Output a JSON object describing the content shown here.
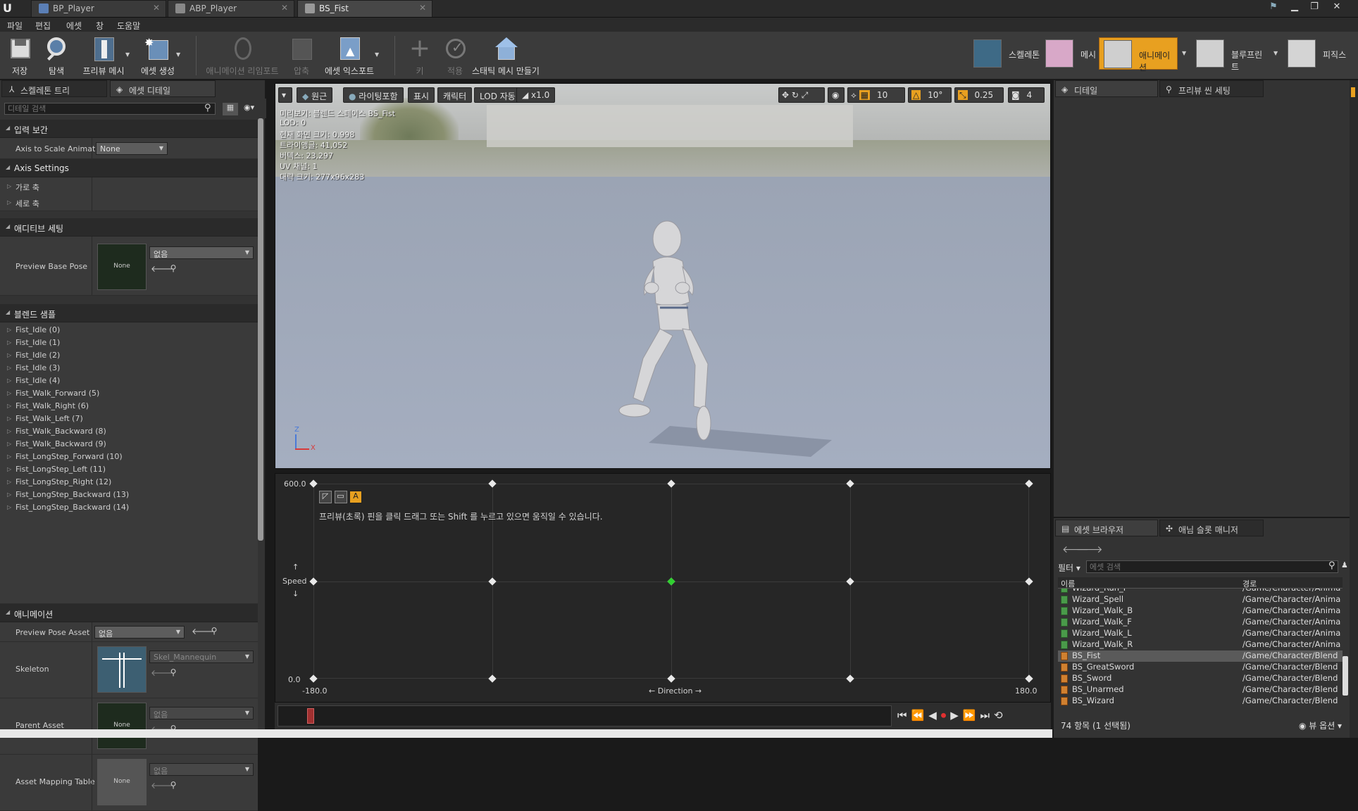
{
  "tabs": [
    {
      "label": "BP_Player"
    },
    {
      "label": "ABP_Player"
    },
    {
      "label": "BS_Fist"
    }
  ],
  "menu": [
    "파일",
    "편집",
    "에셋",
    "창",
    "도움말"
  ],
  "toolbar": {
    "save": "저장",
    "browse": "탐색",
    "preview_mesh": "프리뷰 메시",
    "create_asset": "에셋 생성",
    "reimport": "애니메이션 리임포트",
    "compress": "압축",
    "export_asset": "에셋 익스포트",
    "key": "키",
    "apply": "적용",
    "make_static_mesh": "스태틱 메시 만들기"
  },
  "modes": {
    "skeleton": "스켈레톤",
    "mesh": "메시",
    "animation": "애니메이션",
    "blueprint": "블루프린트",
    "physics": "피직스"
  },
  "left_panel": {
    "tab_skeleton_tree": "스켈레톤 트리",
    "tab_asset_details": "에셋 디테일",
    "search_placeholder": "디테일 검색",
    "section_input_interp": "입력 보간",
    "axis_to_scale_label": "Axis to Scale Animati",
    "axis_to_scale_value": "None",
    "section_axis_settings": "Axis Settings",
    "horizontal_axis": "가로 축",
    "vertical_axis": "세로 축",
    "section_additive": "애디티브 세팅",
    "preview_base_pose": "Preview Base Pose",
    "none": "None",
    "none_kr": "없음",
    "section_blend_samples": "블렌드 샘플",
    "blend_samples": [
      "Fist_Idle (0)",
      "Fist_Idle (1)",
      "Fist_Idle (2)",
      "Fist_Idle (3)",
      "Fist_Idle (4)",
      "Fist_Walk_Forward (5)",
      "Fist_Walk_Right (6)",
      "Fist_Walk_Left (7)",
      "Fist_Walk_Backward (8)",
      "Fist_Walk_Backward (9)",
      "Fist_LongStep_Forward (10)",
      "Fist_LongStep_Left (11)",
      "Fist_LongStep_Right (12)",
      "Fist_LongStep_Backward (13)",
      "Fist_LongStep_Backward (14)"
    ],
    "section_animation": "애니메이션",
    "preview_pose_asset": "Preview Pose Asset",
    "skeleton": "Skeleton",
    "skeleton_value": "Skel_Mannequin",
    "parent_asset": "Parent Asset",
    "asset_mapping_table": "Asset Mapping Table"
  },
  "viewport": {
    "perspective": "원근",
    "lighting": "라이팅포함",
    "show": "표시",
    "character": "캐릭터",
    "lod": "LOD 자동",
    "speed": "x1.0",
    "grid_snap": "10",
    "rot_snap": "10°",
    "scale_snap": "0.25",
    "cam_speed": "4",
    "info": [
      "미리보기: 블렌드 스페이스 BS_Fist",
      "LOD: 0",
      "현재 화면 크기: 0.998",
      "트라이앵글: 41,052",
      "버텍스: 23,297",
      "UV 채널: 1",
      "대략 크기: 277x96x283"
    ],
    "axis_x": "X",
    "axis_z": "Z"
  },
  "blendspace": {
    "hint": "프리뷰(초록) 핀을 클릭 드래그 또는 Shift 를 누르고 있으면 움직일 수 있습니다.",
    "y_max": "600.0",
    "y_min": "0.0",
    "y_label": "Speed",
    "x_min": "-180.0",
    "x_max": "180.0",
    "x_label": "Direction",
    "preview_point": {
      "direction": 0,
      "speed": 300
    }
  },
  "right_panel": {
    "tab_details": "디테일",
    "tab_preview_scene": "프리뷰 씬 세팅",
    "tab_asset_browser": "에셋 브라우저",
    "tab_anim_slot": "애님 슬롯 매니저",
    "filter": "필터",
    "search_placeholder": "에셋 검색",
    "col_name": "이름",
    "col_path": "경로",
    "assets": [
      {
        "name": "Wizard_Run_F",
        "path": "/Game/Character/Anima",
        "kind": "anim"
      },
      {
        "name": "Wizard_Spell",
        "path": "/Game/Character/Anima",
        "kind": "anim"
      },
      {
        "name": "Wizard_Walk_B",
        "path": "/Game/Character/Anima",
        "kind": "anim"
      },
      {
        "name": "Wizard_Walk_F",
        "path": "/Game/Character/Anima",
        "kind": "anim"
      },
      {
        "name": "Wizard_Walk_L",
        "path": "/Game/Character/Anima",
        "kind": "anim"
      },
      {
        "name": "Wizard_Walk_R",
        "path": "/Game/Character/Anima",
        "kind": "anim"
      },
      {
        "name": "BS_Fist",
        "path": "/Game/Character/Blend",
        "kind": "blend"
      },
      {
        "name": "BS_GreatSword",
        "path": "/Game/Character/Blend",
        "kind": "blend"
      },
      {
        "name": "BS_Sword",
        "path": "/Game/Character/Blend",
        "kind": "blend"
      },
      {
        "name": "BS_Unarmed",
        "path": "/Game/Character/Blend",
        "kind": "blend"
      },
      {
        "name": "BS_Wizard",
        "path": "/Game/Character/Blend",
        "kind": "blend"
      }
    ],
    "item_count": "74 항목 (1 선택됨)",
    "view_options": "뷰 옵션"
  },
  "colors": {
    "accent": "#e8a020",
    "preview_pin": "#30d030",
    "selected_row": "#5a5a5a"
  }
}
